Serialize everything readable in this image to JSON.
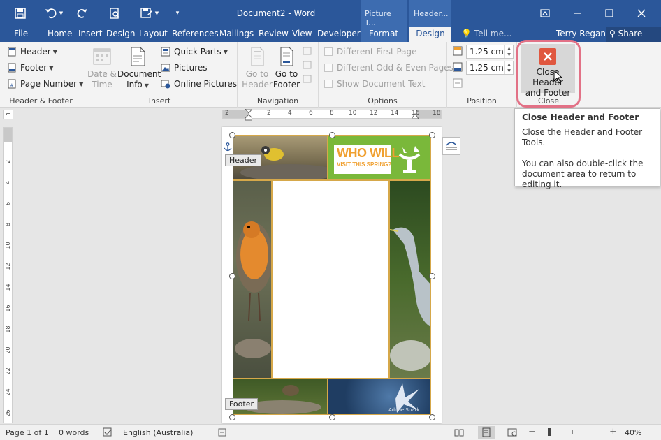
{
  "titlebar": {
    "document_title": "Document2 - Word",
    "context_picture_tools": "Picture T...",
    "context_header_tools": "Header...",
    "icons": [
      "save-icon",
      "undo-icon",
      "redo-icon",
      "print-preview-icon",
      "save-as-icon",
      "customize-qat-icon"
    ],
    "window_icons": [
      "ribbon-display-icon",
      "minimize-icon",
      "maximize-icon",
      "close-icon"
    ]
  },
  "tabs": {
    "file": "File",
    "home": "Home",
    "insert": "Insert",
    "design1": "Design",
    "layout": "Layout",
    "references": "References",
    "mailings": "Mailings",
    "review": "Review",
    "view": "View",
    "developer": "Developer",
    "format": "Format",
    "design2": "Design",
    "tell_me": "Tell me...",
    "user": "Terry Regan",
    "share": "Share"
  },
  "ribbon": {
    "header_footer": {
      "label": "Header & Footer",
      "header": "Header",
      "footer": "Footer",
      "page_number": "Page Number"
    },
    "insert": {
      "label": "Insert",
      "date_time_1": "Date &",
      "date_time_2": "Time",
      "doc_info_1": "Document",
      "doc_info_2": "Info",
      "quick_parts": "Quick Parts",
      "pictures": "Pictures",
      "online_pictures": "Online Pictures"
    },
    "navigation": {
      "label": "Navigation",
      "goto_header_1": "Go to",
      "goto_header_2": "Header",
      "goto_footer_1": "Go to",
      "goto_footer_2": "Footer"
    },
    "options": {
      "label": "Options",
      "different_first_page": "Different First Page",
      "different_odd_even": "Different Odd & Even Pages",
      "show_document_text": "Show Document Text"
    },
    "position": {
      "label": "Position",
      "header_from_top": "1.25 cm",
      "footer_from_bottom": "1.25 cm"
    },
    "close": {
      "label": "Close",
      "button_1": "Close Header",
      "button_2": "and Footer"
    }
  },
  "tooltip": {
    "title": "Close Header and Footer",
    "line1": "Close the Header and Footer Tools.",
    "line2": "You can also double-click the document area to return to editing it."
  },
  "ruler": {
    "h_ticks": [
      "2",
      "2",
      "4",
      "6",
      "8",
      "10",
      "12",
      "14",
      "16",
      "18"
    ],
    "v_ticks": [
      "2",
      "4",
      "6",
      "8",
      "10",
      "12",
      "14",
      "16",
      "18",
      "20",
      "22",
      "24",
      "26"
    ]
  },
  "page": {
    "header_label": "Header",
    "footer_label": "Footer",
    "flyer_line1": "WHO WILL",
    "flyer_line2": "VISIT THIS SPRING?",
    "watermark": "Adobe Spark"
  },
  "statusbar": {
    "page": "Page 1 of 1",
    "words": "0 words",
    "language": "English (Australia)",
    "zoom": "40%"
  },
  "colors": {
    "word_blue": "#2b579a",
    "close_red": "#e0573f",
    "flyer_green": "#7ab83a",
    "flyer_orange": "#f0a030",
    "highlight_ring": "#e27186"
  }
}
